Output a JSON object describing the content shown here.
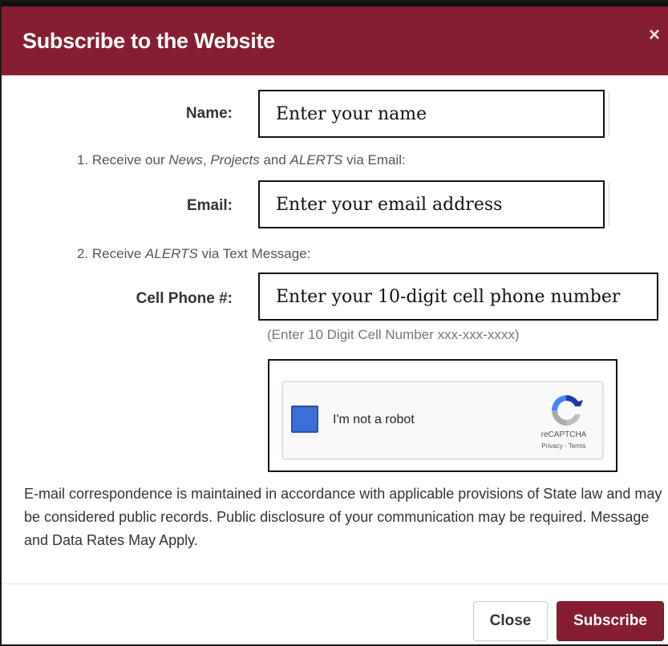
{
  "dialog": {
    "title": "Subscribe to the Website",
    "close_icon": "×"
  },
  "form": {
    "name_label": "Name:",
    "name_placeholder": "Enter your name",
    "email_step": {
      "prefix": "1. Receive our ",
      "news": "News",
      "comma": ", ",
      "projects": "Projects",
      "and": " and ",
      "alerts": "ALERTS",
      "suffix": " via Email:"
    },
    "email_label": "Email:",
    "email_placeholder": "Enter your email address",
    "sms_step": {
      "prefix": "2. Receive ",
      "alerts": "ALERTS",
      "suffix": " via Text Message:"
    },
    "phone_label": "Cell Phone #:",
    "phone_placeholder": "Enter your 10-digit cell phone number",
    "phone_hint": "(Enter 10 Digit Cell Number xxx-xxx-xxxx)"
  },
  "captcha": {
    "checkbox_label": "I'm not a robot",
    "brand": "reCAPTCHA",
    "links": "Privacy - Terms",
    "logo_icon": "recaptcha-logo-icon",
    "checkbox_color": "#3b6fd8"
  },
  "disclaimer": "E-mail correspondence is maintained in accordance with applicable provisions of State law and may be considered public records. Public disclosure of your communication may be required. Message and Data Rates May Apply.",
  "footer": {
    "close_label": "Close",
    "subscribe_label": "Subscribe"
  },
  "colors": {
    "brand": "#861e32",
    "text": "#333333",
    "muted": "#777777"
  }
}
